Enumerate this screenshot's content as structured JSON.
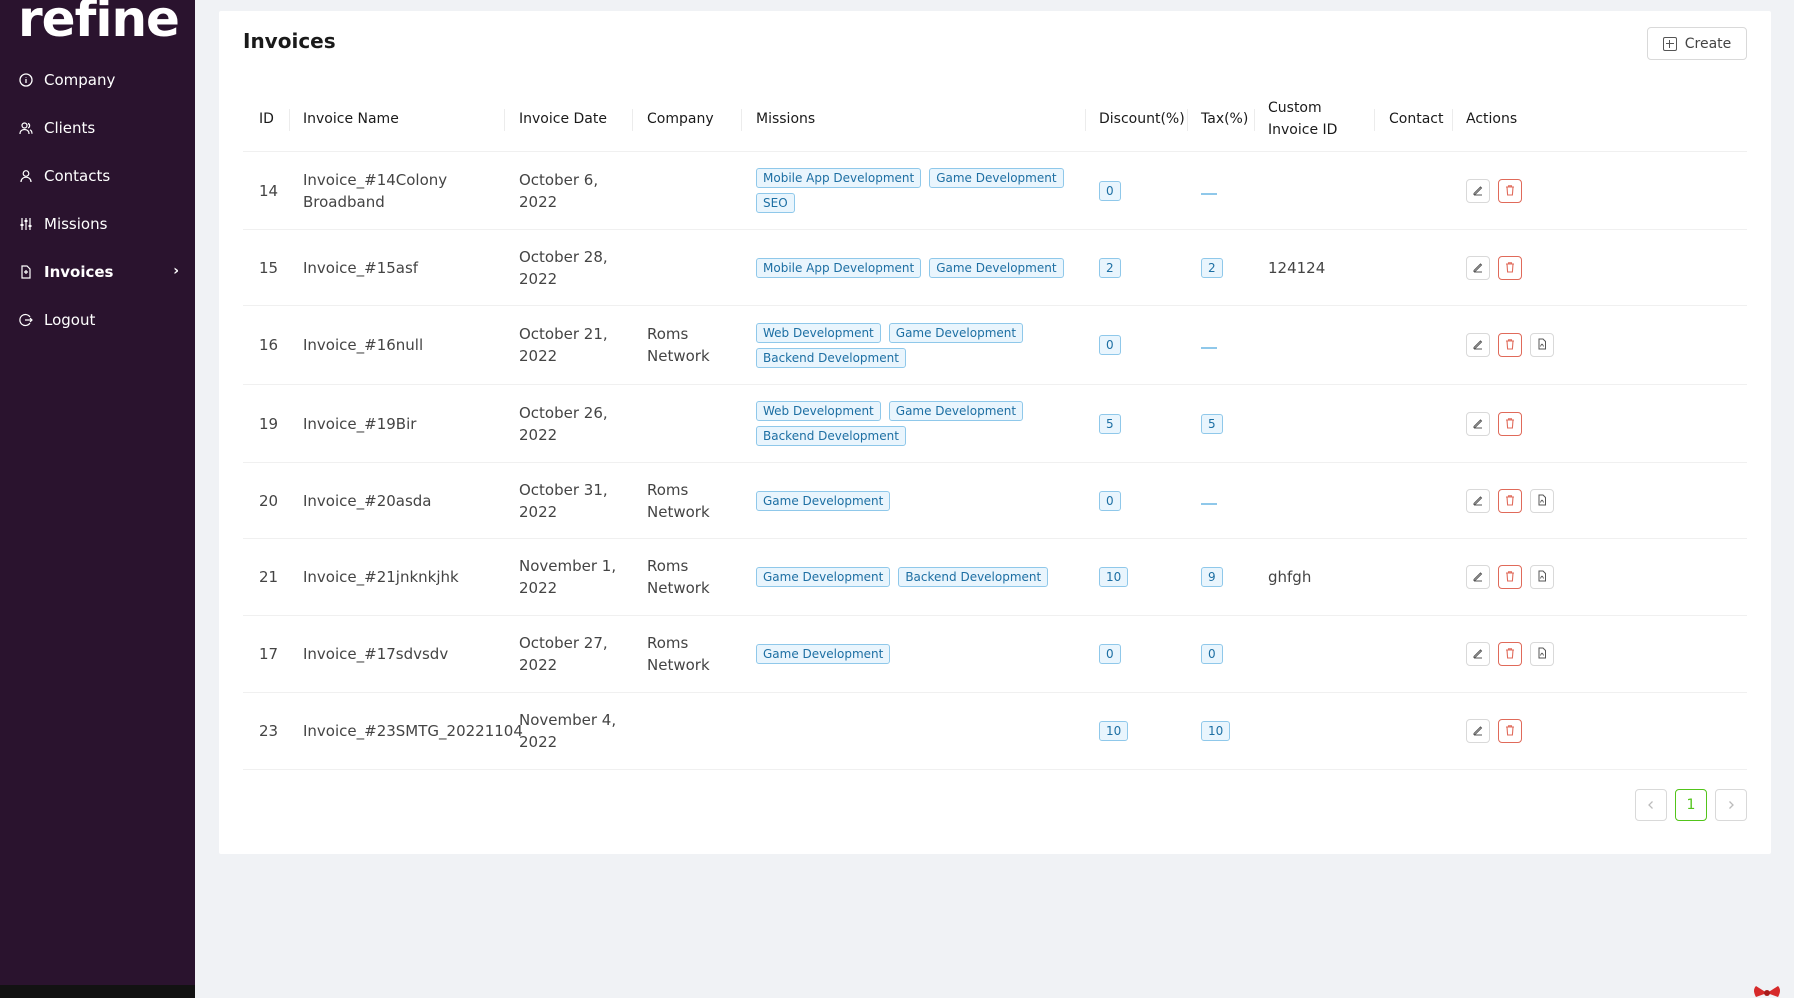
{
  "app": {
    "logo": "refine"
  },
  "sidebar": {
    "items": [
      {
        "label": "Company",
        "icon": "info-icon"
      },
      {
        "label": "Clients",
        "icon": "users-icon"
      },
      {
        "label": "Contacts",
        "icon": "user-icon"
      },
      {
        "label": "Missions",
        "icon": "sliders-icon"
      },
      {
        "label": "Invoices",
        "icon": "file-icon",
        "active": true
      },
      {
        "label": "Logout",
        "icon": "logout-icon"
      }
    ]
  },
  "page": {
    "title": "Invoices",
    "create_label": "Create"
  },
  "table": {
    "columns": [
      "ID",
      "Invoice Name",
      "Invoice Date",
      "Company",
      "Missions",
      "Discount(%)",
      "Tax(%)",
      "Custom Invoice ID",
      "Contact",
      "Actions"
    ],
    "rows": [
      {
        "id": "14",
        "name": "Invoice_#14Colony Broadband",
        "date": "October 6, 2022",
        "company": "",
        "missions": [
          "Mobile App Development",
          "Game Development",
          "SEO"
        ],
        "discount": "0",
        "tax": null,
        "custom_id": "",
        "contact": "",
        "pdf": false
      },
      {
        "id": "15",
        "name": "Invoice_#15asf",
        "date": "October 28, 2022",
        "company": "",
        "missions": [
          "Mobile App Development",
          "Game Development"
        ],
        "discount": "2",
        "tax": "2",
        "custom_id": "124124",
        "contact": "",
        "pdf": false
      },
      {
        "id": "16",
        "name": "Invoice_#16null",
        "date": "October 21, 2022",
        "company": "Roms Network",
        "missions": [
          "Web Development",
          "Game Development",
          "Backend Development"
        ],
        "discount": "0",
        "tax": null,
        "custom_id": "",
        "contact": "",
        "pdf": true
      },
      {
        "id": "19",
        "name": "Invoice_#19Bir",
        "date": "October 26, 2022",
        "company": "",
        "missions": [
          "Web Development",
          "Game Development",
          "Backend Development"
        ],
        "discount": "5",
        "tax": "5",
        "custom_id": "",
        "contact": "",
        "pdf": false
      },
      {
        "id": "20",
        "name": "Invoice_#20asda",
        "date": "October 31, 2022",
        "company": "Roms Network",
        "missions": [
          "Game Development"
        ],
        "discount": "0",
        "tax": null,
        "custom_id": "",
        "contact": "",
        "pdf": true
      },
      {
        "id": "21",
        "name": "Invoice_#21jnknkjhk",
        "date": "November 1, 2022",
        "company": "Roms Network",
        "missions": [
          "Game Development",
          "Backend Development"
        ],
        "discount": "10",
        "tax": "9",
        "custom_id": "ghfgh",
        "contact": "",
        "pdf": true
      },
      {
        "id": "17",
        "name": "Invoice_#17sdvsdv",
        "date": "October 27, 2022",
        "company": "Roms Network",
        "missions": [
          "Game Development"
        ],
        "discount": "0",
        "tax": "0",
        "custom_id": "",
        "contact": "",
        "pdf": true
      },
      {
        "id": "23",
        "name": "Invoice_#23SMTG_20221104",
        "date": "November 4, 2022",
        "company": "",
        "missions": [],
        "discount": "10",
        "tax": "10",
        "custom_id": "",
        "contact": "",
        "pdf": false
      }
    ]
  },
  "pagination": {
    "current": "1"
  },
  "colors": {
    "sidebar": "#2a132e",
    "tag_text": "#1d6fa3",
    "tag_bg": "#e9f5fd",
    "delete": "#e06a5a",
    "page_active": "#52c41a"
  }
}
